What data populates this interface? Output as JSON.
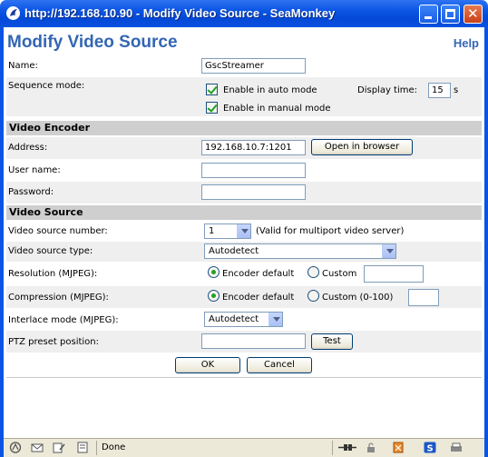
{
  "window": {
    "title": "http://192.168.10.90 - Modify Video Source - SeaMonkey"
  },
  "page": {
    "title": "Modify Video Source",
    "help": "Help"
  },
  "name": {
    "label": "Name:",
    "value": "GscStreamer"
  },
  "sequence": {
    "label": "Sequence mode:",
    "auto_label": "Enable in auto mode",
    "auto_checked": true,
    "display_time_label": "Display time:",
    "display_time_value": "15",
    "display_time_unit": "s",
    "manual_label": "Enable in manual mode",
    "manual_checked": true
  },
  "encoder": {
    "heading": "Video Encoder",
    "address_label": "Address:",
    "address_value": "192.168.10.7:1201",
    "open_browser": "Open in browser",
    "username_label": "User name:",
    "username_value": "",
    "password_label": "Password:",
    "password_value": ""
  },
  "source": {
    "heading": "Video Source",
    "number_label": "Video source number:",
    "number_value": "1",
    "number_note": "(Valid for multiport video server)",
    "type_label": "Video source type:",
    "type_value": "Autodetect",
    "resolution_label": "Resolution (MJPEG):",
    "resolution_default": "Encoder default",
    "resolution_custom": "Custom",
    "resolution_custom_value": "",
    "compression_label": "Compression (MJPEG):",
    "compression_default": "Encoder default",
    "compression_custom": "Custom (0-100)",
    "compression_custom_value": "",
    "interlace_label": "Interlace mode (MJPEG):",
    "interlace_value": "Autodetect",
    "ptz_label": "PTZ preset position:",
    "ptz_value": "",
    "test": "Test"
  },
  "actions": {
    "ok": "OK",
    "cancel": "Cancel"
  },
  "status": {
    "text": "Done"
  },
  "colors": {
    "titlebar": "#0a54e4",
    "heading": "#3366b3",
    "section_bg": "#cfcfcf",
    "row_bg": "#efefef"
  }
}
